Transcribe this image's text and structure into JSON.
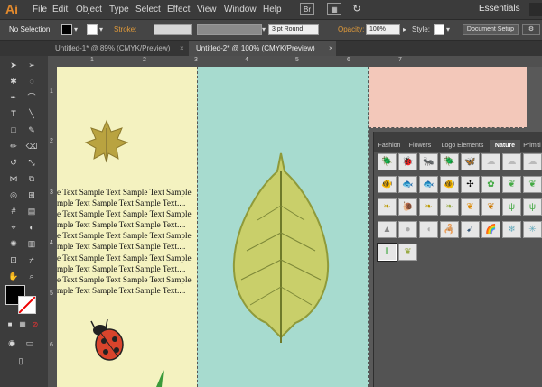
{
  "app": {
    "logo": "Ai"
  },
  "menubar": {
    "items": [
      "File",
      "Edit",
      "Object",
      "Type",
      "Select",
      "Effect",
      "View",
      "Window",
      "Help"
    ],
    "br_label": "Br",
    "workspace": "Essentials"
  },
  "controlbar": {
    "selection": "No Selection",
    "stroke_label": "Stroke:",
    "brush": "3 pt Round",
    "opacity_label": "Opacity:",
    "opacity": "100%",
    "style_label": "Style:",
    "doc_setup": "Document Setup",
    "colors": {
      "fill": "#000000",
      "stroke": "#ff0000",
      "highlight": "#e09a3a"
    }
  },
  "tabs": [
    {
      "label": "Untitled-1* @ 89% (CMYK/Preview)",
      "active": false
    },
    {
      "label": "Untitled-2* @ 100% (CMYK/Preview)",
      "active": true
    }
  ],
  "rulers": {
    "h": [
      "1",
      "2",
      "3",
      "4",
      "5",
      "6",
      "7"
    ],
    "v": [
      "1",
      "2",
      "3",
      "4",
      "5",
      "6"
    ]
  },
  "canvas": {
    "sample_lines": [
      "e Text Sample Text Sample Text Sample",
      "mple Text Sample Text Sample Text....",
      "e Text Sample Text Sample Text Sample",
      "mple Text Sample Text Sample Text....",
      "e Text Sample Text Sample Text Sample",
      "mple Text Sample Text Sample Text....",
      "e Text Sample Text Sample Text Sample",
      "mple Text Sample Text Sample Text....",
      "e Text Sample Text Sample Text Sample",
      "mple Text Sample Text Sample Text...."
    ],
    "colors": {
      "yellow": "#f4f2c0",
      "teal": "#a7dbcf",
      "pink": "#f3c8ba"
    }
  },
  "symbols_panel": {
    "tabs": [
      "Fashion",
      "Flowers",
      "Logo Elements",
      "Nature",
      "Primiti"
    ],
    "active_tab": "Nature",
    "symbols": [
      "beetle-icon",
      "ladybug-icon",
      "bug-icon",
      "beetle-icon",
      "butterfly-icon",
      "cloud-icon",
      "fish-icon",
      "fish-icon",
      "fish-icon",
      "fish-icon",
      "dragonfly-icon",
      "plant-icon",
      "leaf-icon",
      "leaf-icon",
      "snail-icon",
      "leaf-icon",
      "leaf-icon",
      "grass-icon",
      "rock-icon",
      "rock-icon",
      "scorpion-icon",
      "fish-icon",
      "rainbow-icon",
      "snowflake-icon",
      "grass-icon",
      "leaf-icon"
    ]
  }
}
